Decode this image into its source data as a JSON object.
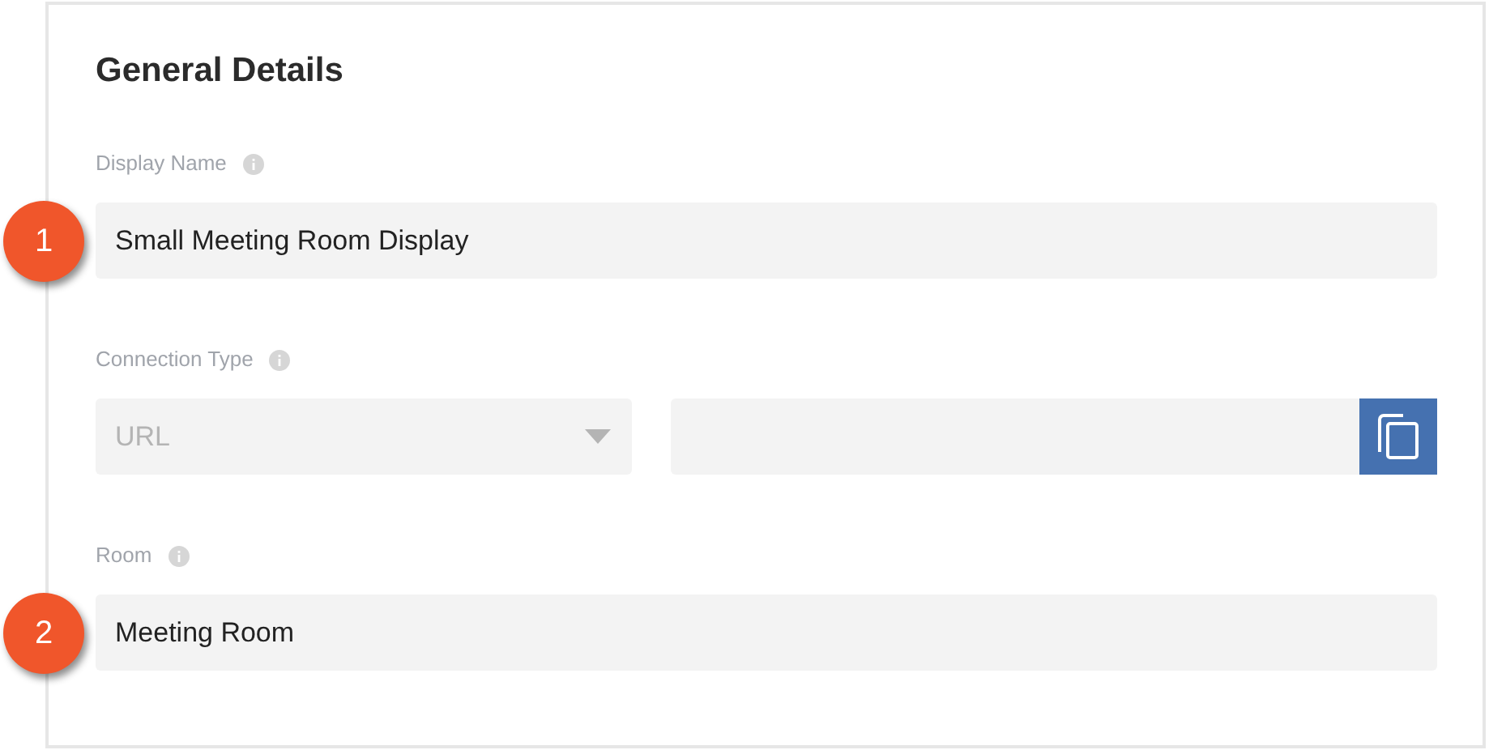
{
  "section": {
    "title": "General Details"
  },
  "fields": [
    {
      "kind": "text",
      "label": "Display Name",
      "value": "Small Meeting Room Display",
      "callout": "1"
    },
    {
      "kind": "select-copy",
      "label": "Connection Type",
      "value": "URL",
      "disabled": true
    },
    {
      "kind": "text",
      "label": "Room",
      "value": "Meeting Room",
      "callout": "2"
    }
  ]
}
